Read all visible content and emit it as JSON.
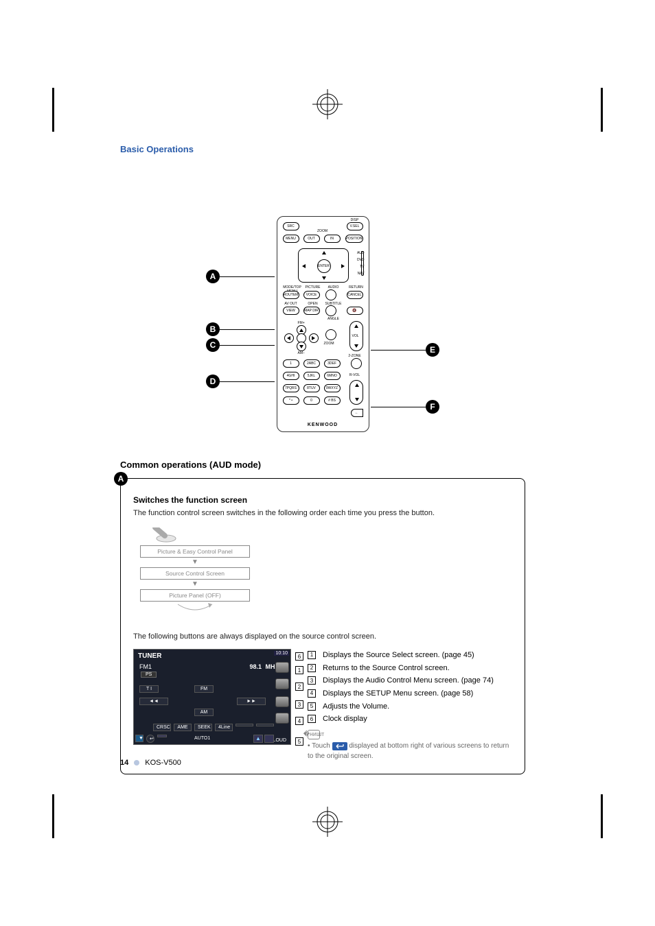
{
  "chapter": "Basic Operations",
  "page_number": "14",
  "model": "KOS-V500",
  "section_heading": "Common operations (AUD mode)",
  "topic": {
    "callout_letter": "A",
    "title": "Switches the function screen",
    "intro": "The function control screen switches in the following order each time you press the button.",
    "flow": [
      "Picture & Easy Control Panel",
      "Source Control Screen",
      "Picture Panel (OFF)"
    ],
    "buttons_intro": "The following buttons are always displayed on the source control screen.",
    "note_bullet": "Touch           displayed at bottom right of various screens to return to the original screen.",
    "note_prefix": "Touch",
    "note_suffix": "displayed at bottom right of various screens to return to the original screen."
  },
  "screenshot": {
    "title": "TUNER",
    "band": "FM1",
    "freq": "98.1",
    "unit": "MHz",
    "ps": "PS",
    "ti": "T I",
    "fm": "FM",
    "am": "AM",
    "prev": "◄◄",
    "next": "►►",
    "bottom": [
      "CRSC",
      "AME",
      "SEEK",
      "4Line",
      "",
      ""
    ],
    "mode": "AUTO1",
    "loud": "LOUD",
    "clock": "10:10"
  },
  "legend": [
    {
      "n": "1",
      "text": "Displays the Source Select screen. (page 45)"
    },
    {
      "n": "2",
      "text": "Returns to the Source Control screen."
    },
    {
      "n": "3",
      "text": "Displays the Audio Control Menu screen. (page 74)"
    },
    {
      "n": "4",
      "text": "Displays the SETUP Menu screen. (page 58)"
    },
    {
      "n": "5",
      "text": "Adjusts the Volume."
    },
    {
      "n": "6",
      "text": "Clock display"
    }
  ],
  "remote_callouts": [
    "A",
    "B",
    "C",
    "D",
    "E",
    "F"
  ],
  "remote": {
    "brand": "KENWOOD",
    "top": {
      "src": "SRC",
      "disp": "DISP",
      "vsel": "V.SEL",
      "menu": "MENU",
      "out": "OUT",
      "in": "IN",
      "position": "POSITION",
      "zoom": "ZOOM"
    },
    "mid": {
      "enter": "ENTER",
      "aud": "AUD",
      "dvd": "DVD",
      "tv": "TV",
      "nav": "NAV"
    },
    "row1": {
      "modetop": "MODE/TOP MENU",
      "picture": "PICTURE",
      "audio": "AUDIO",
      "return": "RETURN",
      "routem": "ROUTEM",
      "voice": "VOICE",
      "cancel": "CANCEL"
    },
    "row2": {
      "avout": "AV OUT",
      "open": "OPEN",
      "subtitle": "SUBTITLE",
      "view": "VIEW",
      "mapdir": "MAP DIR",
      "angle": "ANGLE"
    },
    "cross": {
      "fm": "FM+",
      "am": "AM−",
      "zoom": "ZOOM",
      "vol": "VOL"
    },
    "keypad": {
      "1": "1",
      "2": "2ABC",
      "3": "3DEF",
      "4": "4GHI",
      "5": "5JKL",
      "6": "6MNO",
      "7": "7PQRS",
      "8": "8TUV",
      "9": "9WXYZ",
      "0": "0",
      "star": "* •",
      "hash": "# BS",
      "twozone": "2-ZONE",
      "rvol": "R-VOL"
    }
  },
  "ss_pointer_labels": [
    "1",
    "2",
    "3",
    "4",
    "5",
    "6"
  ]
}
